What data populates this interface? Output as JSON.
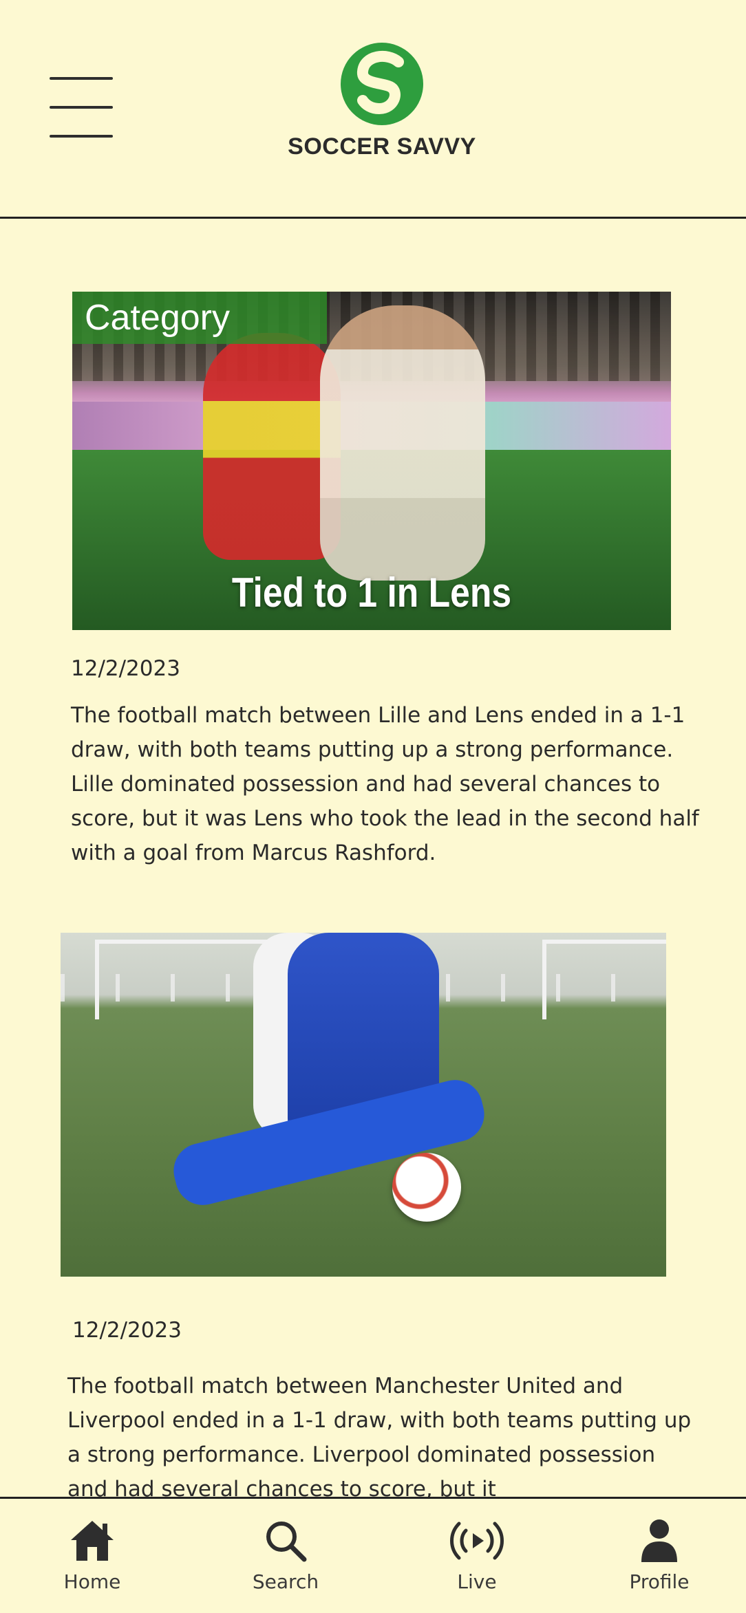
{
  "header": {
    "brand_name": "SOCCER SAVVY",
    "menu_icon": "hamburger-menu-icon",
    "logo_icon": "soccer-savvy-logo",
    "accent_color": "#2e9e3e"
  },
  "articles": [
    {
      "category": "Category",
      "image_title": "Tied to 1 in Lens",
      "date": "12/2/2023",
      "body": "The football match between Lille and Lens ended in a 1-1 draw, with both teams putting up a strong performance. Lille dominated possession and had several chances to score, but it was Lens who took the lead in the second half with a goal from Marcus Rashford."
    },
    {
      "date": "12/2/2023",
      "body": "The football match between Manchester United and Liverpool ended in a 1-1 draw, with both teams putting up a strong performance. Liverpool dominated possession and had several chances to score, but it"
    }
  ],
  "bottom_nav": {
    "items": [
      {
        "label": "Home",
        "icon": "home-icon"
      },
      {
        "label": "Search",
        "icon": "search-icon"
      },
      {
        "label": "Live",
        "icon": "live-broadcast-icon"
      },
      {
        "label": "Profile",
        "icon": "profile-icon"
      }
    ]
  },
  "colors": {
    "background": "#fdf9d2",
    "text": "#2a2a2a",
    "category_badge": "#2e8c28"
  }
}
